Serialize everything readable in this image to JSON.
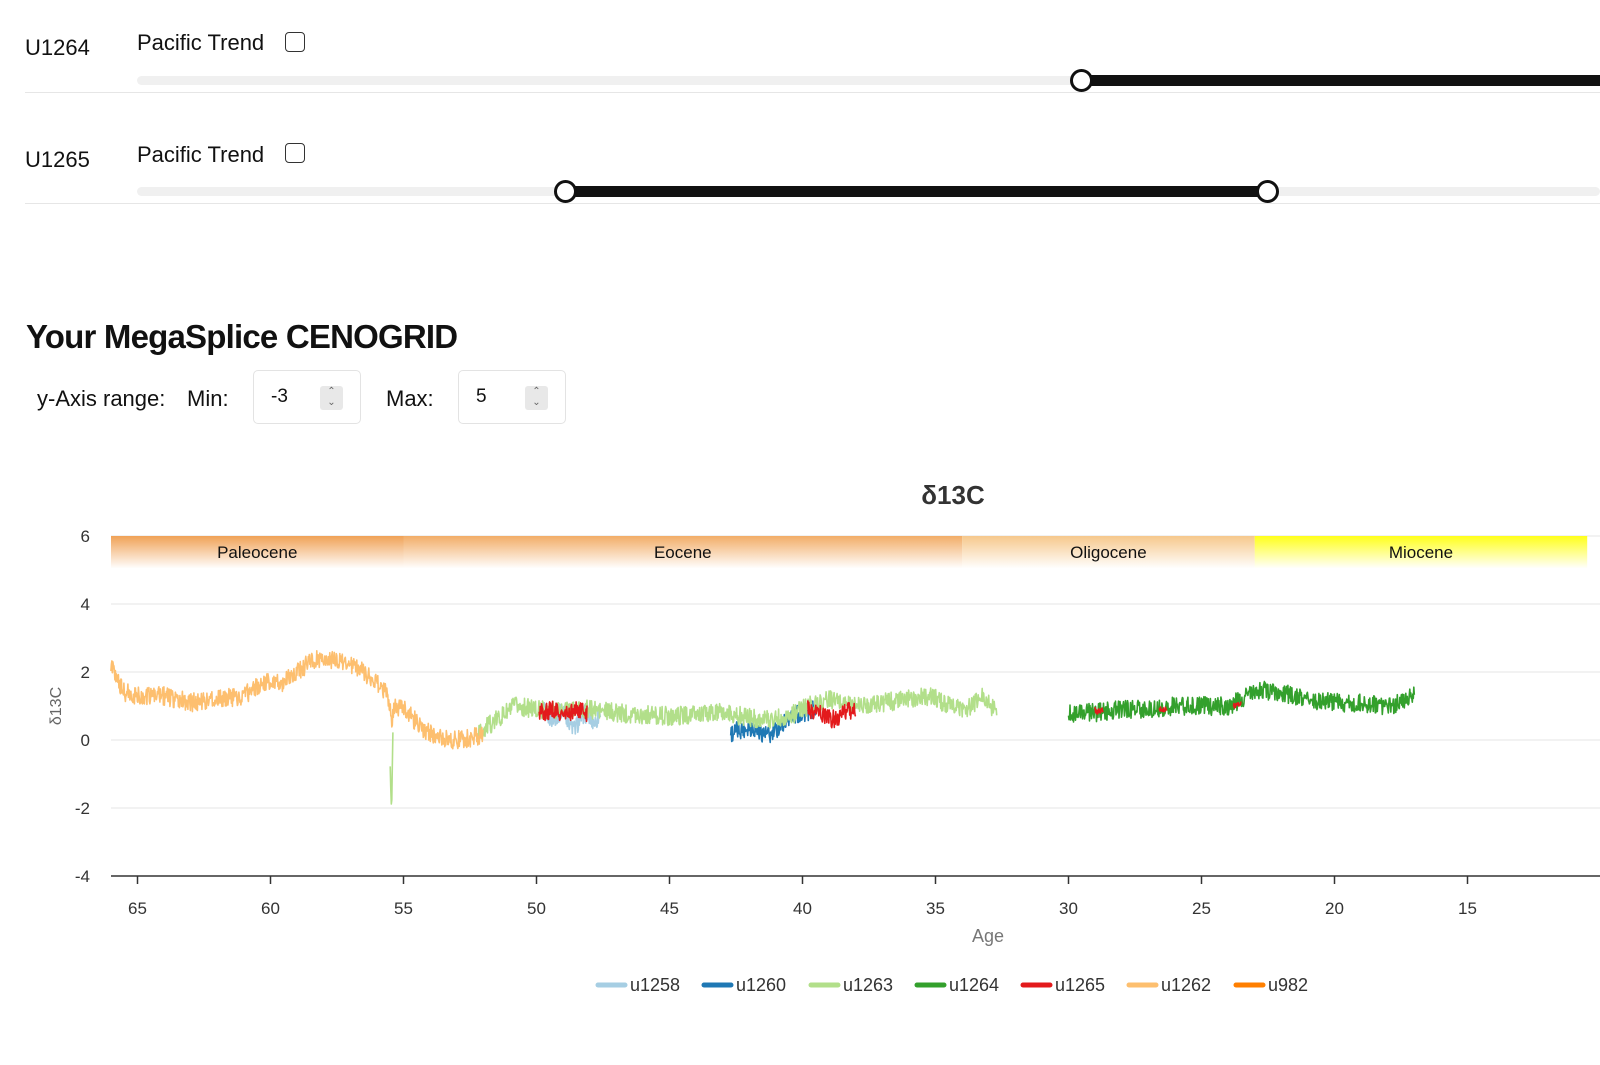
{
  "sites": [
    {
      "name": "U1264",
      "trend_label": "Pacific Trend",
      "trend_checked": false,
      "range_fraction": [
        0.6,
        1.0
      ]
    },
    {
      "name": "U1265",
      "trend_label": "Pacific Trend",
      "trend_checked": false,
      "range_fraction": [
        0.29,
        0.745
      ]
    }
  ],
  "section_title": "Your MegaSplice CENOGRID",
  "y_axis_range": {
    "label": "y-Axis range:",
    "min_label": "Min:",
    "min_value": "-3",
    "max_label": "Max:",
    "max_value": "5"
  },
  "chart_data": {
    "type": "line",
    "title": "δ13C",
    "xlabel": "Age",
    "ylabel": "δ13C",
    "xlim": [
      66,
      10.5
    ],
    "x_reversed": true,
    "ylim": [
      -4,
      6
    ],
    "xticks": [
      "65",
      "60",
      "55",
      "50",
      "45",
      "40",
      "35",
      "30",
      "25",
      "20",
      "15"
    ],
    "yticks": [
      "6",
      "4",
      "2",
      "0",
      "-2",
      "-4"
    ],
    "grid": true,
    "legend_position": "bottom",
    "epochs": [
      {
        "name": "Paleocene",
        "start": 66,
        "end": 55,
        "color": "#f0a256"
      },
      {
        "name": "Eocene",
        "start": 55,
        "end": 34,
        "color": "#f2ad67"
      },
      {
        "name": "Oligocene",
        "start": 34,
        "end": 23,
        "color": "#f6c88c"
      },
      {
        "name": "Miocene",
        "start": 23,
        "end": 10.5,
        "color": "#ffff1a"
      }
    ],
    "series": [
      {
        "name": "u1258",
        "color": "#a6cee3",
        "segments": [
          {
            "from": 49.8,
            "to": 47.6,
            "points": [
              [
                49.8,
                0.9
              ],
              [
                49.4,
                0.6
              ],
              [
                49.0,
                0.9
              ],
              [
                48.6,
                0.3
              ],
              [
                48.2,
                0.8
              ],
              [
                47.8,
                0.5
              ],
              [
                47.6,
                0.8
              ]
            ]
          }
        ]
      },
      {
        "name": "u1260",
        "color": "#1f78b4",
        "segments": [
          {
            "from": 42.7,
            "to": 39.5,
            "points": [
              [
                42.7,
                0.2
              ],
              [
                42.0,
                0.4
              ],
              [
                41.2,
                0.1
              ],
              [
                40.5,
                0.7
              ],
              [
                39.9,
                0.8
              ],
              [
                39.5,
                0.9
              ]
            ]
          }
        ]
      },
      {
        "name": "u1263",
        "color": "#b2df8a",
        "segments": [
          {
            "from": 55.5,
            "to": 55.4,
            "points": [
              [
                55.5,
                -0.8
              ],
              [
                55.45,
                -2.2
              ],
              [
                55.4,
                0.2
              ]
            ]
          },
          {
            "from": 52.2,
            "to": 32.7,
            "points": [
              [
                52.2,
                0.2
              ],
              [
                51.5,
                0.6
              ],
              [
                50.8,
                1.0
              ],
              [
                50.0,
                0.9
              ],
              [
                49.0,
                0.9
              ],
              [
                48.0,
                0.9
              ],
              [
                47.0,
                0.8
              ],
              [
                45.0,
                0.7
              ],
              [
                43.0,
                0.8
              ],
              [
                41.5,
                0.6
              ],
              [
                40.5,
                0.7
              ],
              [
                39.8,
                1.0
              ],
              [
                39.0,
                1.2
              ],
              [
                38.0,
                1.0
              ],
              [
                37.0,
                1.1
              ],
              [
                36.0,
                1.2
              ],
              [
                35.2,
                1.3
              ],
              [
                34.5,
                1.0
              ],
              [
                33.8,
                0.9
              ],
              [
                33.2,
                1.3
              ],
              [
                32.7,
                0.8
              ]
            ]
          }
        ]
      },
      {
        "name": "u1264",
        "color": "#33a02c",
        "segments": [
          {
            "from": 30.0,
            "to": 17.0,
            "points": [
              [
                30.0,
                0.8
              ],
              [
                29.0,
                0.8
              ],
              [
                28.0,
                0.9
              ],
              [
                27.0,
                0.9
              ],
              [
                26.0,
                1.0
              ],
              [
                25.0,
                1.0
              ],
              [
                24.0,
                1.0
              ],
              [
                23.5,
                1.2
              ],
              [
                23.0,
                1.5
              ],
              [
                22.0,
                1.4
              ],
              [
                21.0,
                1.2
              ],
              [
                20.0,
                1.1
              ],
              [
                19.0,
                1.1
              ],
              [
                18.0,
                1.0
              ],
              [
                17.5,
                1.1
              ],
              [
                17.0,
                1.3
              ]
            ]
          }
        ]
      },
      {
        "name": "u1265",
        "color": "#e31a1c",
        "segments": [
          {
            "from": 49.9,
            "to": 48.1,
            "points": [
              [
                49.9,
                0.8
              ],
              [
                49.4,
                0.9
              ],
              [
                49.0,
                0.7
              ],
              [
                48.5,
                0.9
              ],
              [
                48.1,
                0.8
              ]
            ]
          },
          {
            "from": 39.8,
            "to": 38.0,
            "points": [
              [
                39.8,
                0.9
              ],
              [
                39.3,
                0.8
              ],
              [
                38.9,
                0.6
              ],
              [
                38.4,
                0.8
              ],
              [
                38.0,
                0.9
              ]
            ]
          },
          {
            "from": 29.0,
            "to": 28.7,
            "points": [
              [
                29.0,
                0.8
              ],
              [
                28.7,
                0.9
              ]
            ]
          },
          {
            "from": 26.6,
            "to": 26.3,
            "points": [
              [
                26.6,
                0.9
              ],
              [
                26.3,
                0.9
              ]
            ]
          },
          {
            "from": 23.8,
            "to": 23.5,
            "points": [
              [
                23.8,
                1.0
              ],
              [
                23.5,
                1.1
              ]
            ]
          }
        ]
      },
      {
        "name": "u1262",
        "color": "#fdbf6f",
        "segments": [
          {
            "from": 66.0,
            "to": 52.0,
            "points": [
              [
                66.0,
                2.2
              ],
              [
                65.5,
                1.4
              ],
              [
                65.0,
                1.3
              ],
              [
                64.0,
                1.3
              ],
              [
                63.0,
                1.1
              ],
              [
                62.0,
                1.2
              ],
              [
                61.0,
                1.3
              ],
              [
                60.5,
                1.6
              ],
              [
                60.0,
                1.7
              ],
              [
                59.5,
                1.7
              ],
              [
                59.0,
                2.0
              ],
              [
                58.5,
                2.3
              ],
              [
                58.0,
                2.4
              ],
              [
                57.5,
                2.3
              ],
              [
                57.0,
                2.2
              ],
              [
                56.5,
                2.0
              ],
              [
                56.0,
                1.7
              ],
              [
                55.6,
                1.3
              ],
              [
                55.45,
                0.6
              ],
              [
                55.3,
                1.0
              ],
              [
                55.0,
                0.9
              ],
              [
                54.6,
                0.6
              ],
              [
                54.2,
                0.3
              ],
              [
                53.8,
                0.1
              ],
              [
                53.3,
                0.0
              ],
              [
                52.8,
                0.0
              ],
              [
                52.3,
                0.1
              ],
              [
                52.0,
                0.1
              ]
            ]
          }
        ]
      },
      {
        "name": "u982",
        "color": "#ff7f00",
        "segments": []
      }
    ]
  }
}
